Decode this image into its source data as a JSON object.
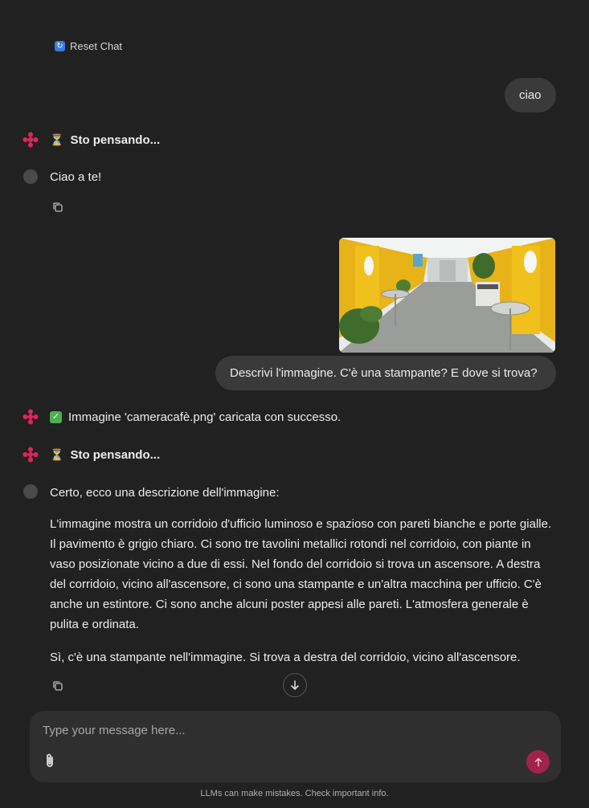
{
  "header": {
    "reset_label": "Reset Chat",
    "reset_icon": "refresh-icon"
  },
  "messages": {
    "user_1": "ciao",
    "thinking_1": "Sto pensando...",
    "bot_1": "Ciao a te!",
    "user_2": "Descrivi l'immagine. C'è una stampante? E dove si trova?",
    "upload_status": "Immagine 'cameracafè.png' caricata con successo.",
    "thinking_2": "Sto pensando...",
    "bot_2_intro": "Certo, ecco una descrizione dell'immagine:",
    "bot_2_para1": "L'immagine mostra un corridoio d'ufficio luminoso e spazioso con pareti bianche e porte gialle. Il pavimento è grigio chiaro. Ci sono tre tavolini metallici rotondi nel corridoio, con piante in vaso posizionate vicino a due di essi. Nel fondo del corridoio si trova un ascensore. A destra del corridoio, vicino all'ascensore, ci sono una stampante e un'altra macchina per ufficio. C'è anche un estintore. Ci sono anche alcuni poster appesi alle pareti. L'atmosfera generale è pulita e ordinata.",
    "bot_2_para2": "Sì, c'è una stampante nell'immagine. Si trova a destra del corridoio, vicino all'ascensore."
  },
  "composer": {
    "placeholder": "Type your message here..."
  },
  "footer": {
    "disclaimer": "LLMs can make mistakes. Check important info."
  },
  "colors": {
    "background": "#212121",
    "bubble": "#3a3a3a",
    "accent": "#a1224a",
    "logo": "#e0245e"
  }
}
